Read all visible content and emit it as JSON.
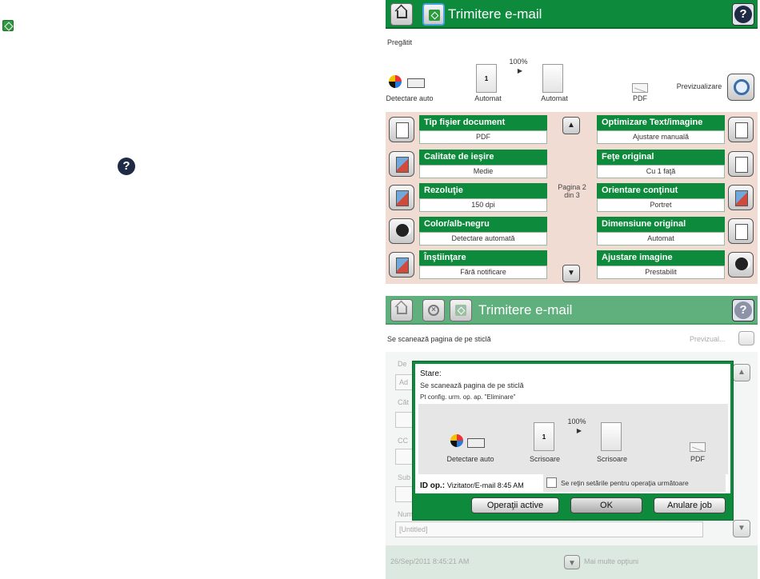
{
  "panel1": {
    "title": "Trimitere e-mail",
    "status": "Pregătit",
    "zoom": "100%",
    "detect": "Detectare auto",
    "orig_size": "Automat",
    "out_size": "Automat",
    "file_type": "PDF",
    "preview_label": "Previzualizare",
    "page_number": "1",
    "pagination": "Pagina 2\ndin 3",
    "settings": [
      {
        "title": "Tip fişier document",
        "value": "PDF"
      },
      {
        "title": "Calitate de ieşire",
        "value": "Medie"
      },
      {
        "title": "Rezoluţie",
        "value": "150 dpi"
      },
      {
        "title": "Color/alb-negru",
        "value": "Detectare automată"
      },
      {
        "title": "Înştiinţare",
        "value": "Fără notificare"
      },
      {
        "title": "Optimizare Text/imagine",
        "value": "Ajustare manuală"
      },
      {
        "title": "Feţe original",
        "value": "Cu 1 faţă"
      },
      {
        "title": "Orientare conţinut",
        "value": "Portret"
      },
      {
        "title": "Dimensiune original",
        "value": "Automat"
      },
      {
        "title": "Ajustare imagine",
        "value": "Prestabilit"
      }
    ]
  },
  "panel2": {
    "title": "Trimitere e-mail",
    "status": "Se scanează pagina de pe sticlă",
    "preview_label": "Previzual...",
    "faded_labels": [
      "De",
      "Ad",
      "Căt",
      "CC",
      "Sub",
      "Num"
    ],
    "untitled": "[Untitled]",
    "timestamp": "26/Sep/2011 8:45:21 AM",
    "more_options": "Mai multe opţiuni",
    "modal": {
      "status_label": "Stare:",
      "status_msg": "Se scanează pagina de pe sticlă",
      "hint": "Pt config. urm. op. ap. \"Eliminare\"",
      "zoom": "100%",
      "detect": "Detectare auto",
      "orig_size": "Scrisoare",
      "out_size": "Scrisoare",
      "file_type": "PDF",
      "page_number": "1",
      "job_label": "ID op.:",
      "job_value": "Vizitator/E-mail 8:45 AM",
      "retain_label": "Se reţin setările pentru operaţia următoare",
      "btn_active": "Operaţii active",
      "btn_ok": "OK",
      "btn_cancel": "Anulare job"
    }
  },
  "colors": {
    "brand_green": "#0e8a3c",
    "grid_bg": "#f1dcd3"
  }
}
